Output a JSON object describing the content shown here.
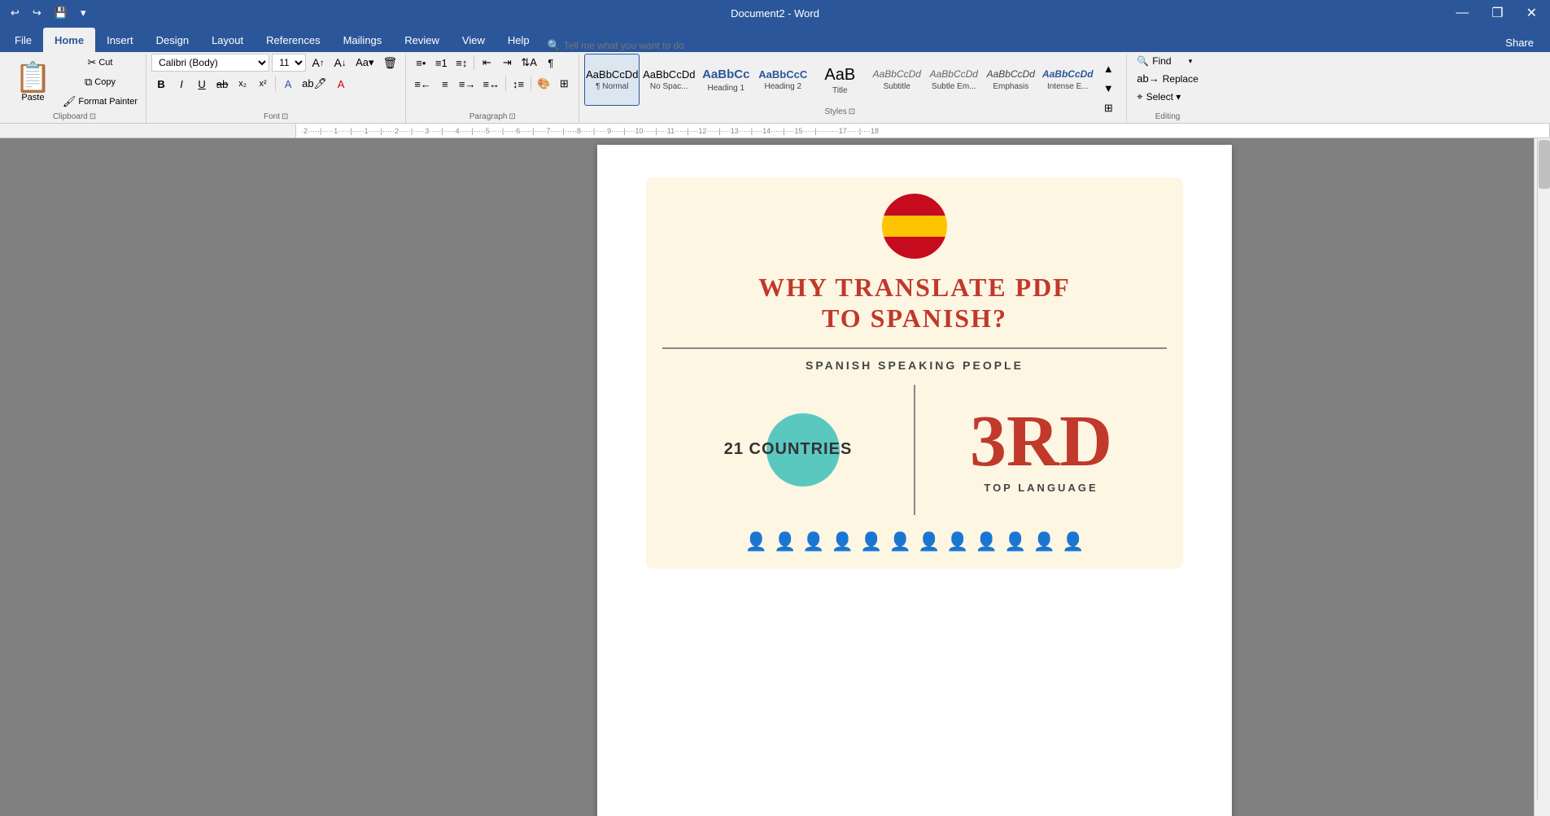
{
  "titlebar": {
    "qat": [
      "undo",
      "redo",
      "save",
      "customize"
    ],
    "title": "Document2 - Word",
    "controls": [
      "minimize",
      "restore",
      "close"
    ]
  },
  "ribbon": {
    "tabs": [
      "File",
      "Home",
      "Insert",
      "Design",
      "Layout",
      "References",
      "Mailings",
      "Review",
      "View",
      "Help",
      "Tell me"
    ],
    "active_tab": "Home",
    "tell_me_placeholder": "Tell me what you want to do",
    "groups": {
      "clipboard": {
        "label": "Clipboard",
        "paste_label": "Paste",
        "cut_label": "Cut",
        "copy_label": "Copy",
        "format_painter_label": "Format Painter"
      },
      "font": {
        "label": "Font",
        "font_name": "Calibri (Body)",
        "font_size": "11",
        "bold": "B",
        "italic": "I",
        "underline": "U"
      },
      "paragraph": {
        "label": "Paragraph"
      },
      "styles": {
        "label": "Styles",
        "items": [
          {
            "name": "Normal",
            "preview": "AaBbCcDd",
            "class": "normal",
            "active": true
          },
          {
            "name": "No Spac...",
            "preview": "AaBbCcDd",
            "class": "nospac"
          },
          {
            "name": "Heading 1",
            "preview": "AaBbCc",
            "class": "h1"
          },
          {
            "name": "Heading 2",
            "preview": "AaBbCcC",
            "class": "h2"
          },
          {
            "name": "Title",
            "preview": "AaB",
            "class": "title"
          },
          {
            "name": "Subtitle",
            "preview": "AaBbCcDd",
            "class": "subtitle"
          },
          {
            "name": "Subtle Em...",
            "preview": "AaBbCcDd",
            "class": "subtleem"
          },
          {
            "name": "Emphasis",
            "preview": "AaBbCcDd",
            "class": "emphasis"
          },
          {
            "name": "Intense E...",
            "preview": "AaBbCcDd",
            "class": "intense"
          }
        ]
      },
      "editing": {
        "label": "Editing",
        "find_label": "Find",
        "replace_label": "Replace",
        "select_label": "Select ▾"
      }
    }
  },
  "document": {
    "content": {
      "flag_alt": "Spain flag",
      "title_line1": "WHY TRANSLATE PDF",
      "title_line2": "TO SPANISH?",
      "subtitle": "SPANISH SPEAKING PEOPLE",
      "left_stat": "21 COUNTRIES",
      "right_stat": "3RD",
      "right_label": "TOP LANGUAGE",
      "people_count": 12
    }
  },
  "share": {
    "label": "Share"
  }
}
